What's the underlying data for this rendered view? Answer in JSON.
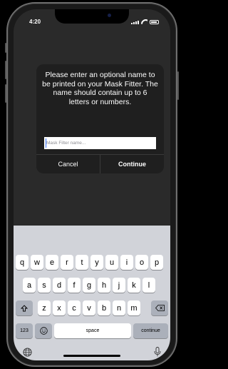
{
  "status": {
    "time": "4:20"
  },
  "dialog": {
    "message": "Please enter an optional name to be printed on your Mask Fitter. The name should contain up to 6 letters or numbers.",
    "input_value": "",
    "input_placeholder": "Mask Filter name...",
    "cancel_label": "Cancel",
    "continue_label": "Continue"
  },
  "keyboard": {
    "row1": [
      "q",
      "w",
      "e",
      "r",
      "t",
      "y",
      "u",
      "i",
      "o",
      "p"
    ],
    "row2": [
      "a",
      "s",
      "d",
      "f",
      "g",
      "h",
      "j",
      "k",
      "l"
    ],
    "row3": [
      "z",
      "x",
      "c",
      "v",
      "b",
      "n",
      "m"
    ],
    "numbers_label": "123",
    "space_label": "space",
    "return_label": "continue",
    "shift_icon": "shift-icon",
    "delete_icon": "delete-icon",
    "emoji_icon": "emoji-icon",
    "globe_icon": "globe-icon",
    "mic_icon": "microphone-icon"
  }
}
